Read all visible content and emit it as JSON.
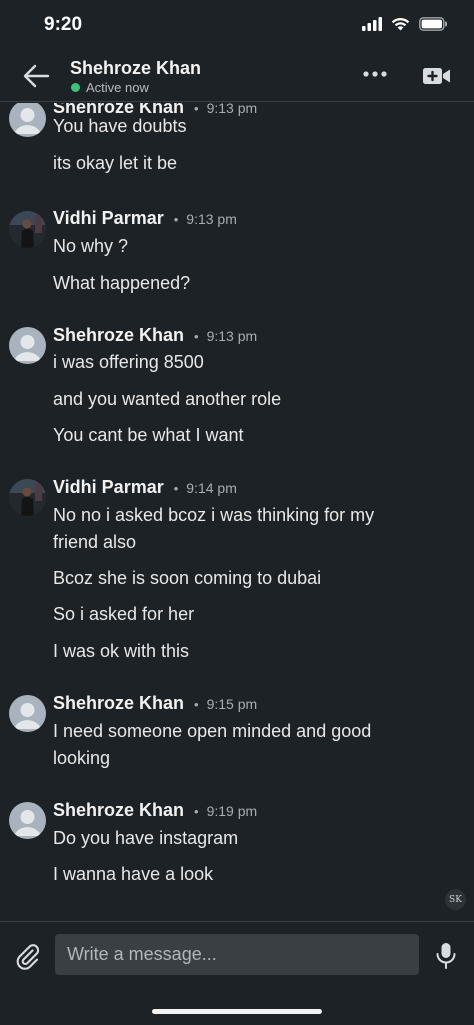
{
  "status_bar": {
    "time": "9:20"
  },
  "header": {
    "contact_name": "Shehroze Khan",
    "presence": "Active now",
    "presence_color": "#3ec27a"
  },
  "groups": [
    {
      "sender": "Shehroze Khan",
      "time": "9:13 pm",
      "avatar": "default-avatar",
      "messages": [
        "You have doubts",
        "its okay let it be"
      ]
    },
    {
      "sender": "Vidhi Parmar",
      "time": "9:13 pm",
      "avatar": "photo-avatar",
      "messages": [
        "No why ?",
        "What happened?"
      ]
    },
    {
      "sender": "Shehroze Khan",
      "time": "9:13 pm",
      "avatar": "default-avatar",
      "messages": [
        "i was offering 8500",
        "and you wanted another role",
        "You cant be what I want"
      ]
    },
    {
      "sender": "Vidhi Parmar",
      "time": "9:14 pm",
      "avatar": "photo-avatar",
      "messages": [
        "No no i asked bcoz i was thinking for my friend also",
        "Bcoz she is soon coming to dubai",
        "So i asked for her",
        "I was ok with this"
      ]
    },
    {
      "sender": "Shehroze Khan",
      "time": "9:15 pm",
      "avatar": "default-avatar",
      "messages": [
        "I need someone open minded and good looking"
      ]
    },
    {
      "sender": "Shehroze Khan",
      "time": "9:19 pm",
      "avatar": "default-avatar",
      "messages": [
        "Do you have instagram",
        "I wanna have a look"
      ]
    }
  ],
  "seen_badge": "SK",
  "composer": {
    "placeholder": "Write a message..."
  },
  "icons": {
    "back": "back-arrow-icon",
    "more": "more-dots-icon",
    "video": "video-call-icon",
    "attach": "paperclip-icon",
    "mic": "microphone-icon"
  }
}
